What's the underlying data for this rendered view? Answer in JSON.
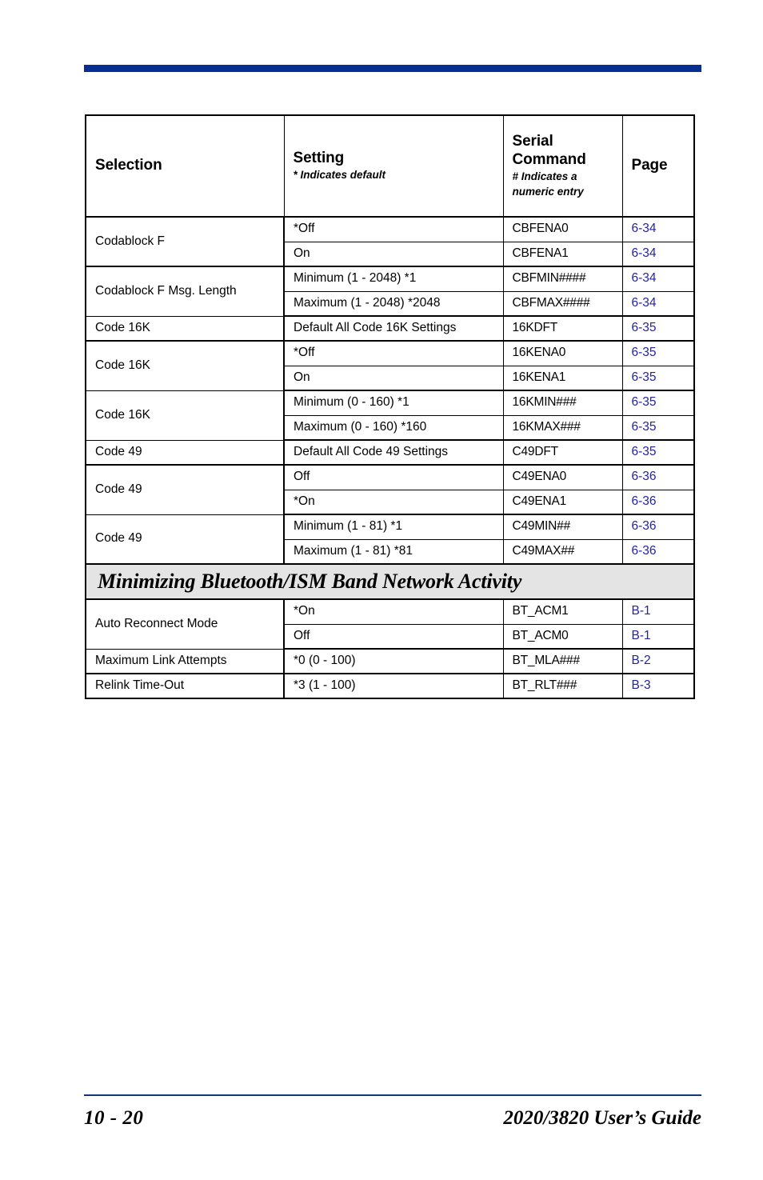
{
  "page": {
    "accent_blue": "#062f91",
    "link_blue": "#2222aa",
    "band_gray": "#e4e4e4"
  },
  "table": {
    "headers": {
      "selection": "Selection",
      "setting": "Setting",
      "setting_note": "* Indicates default",
      "serial_command_line1": "Serial",
      "serial_command_line2": "Command",
      "serial_command_note_line1": "# Indicates a",
      "serial_command_note_line2": "numeric entry",
      "page": "Page"
    },
    "rows": [
      {
        "selection": "Codablock F",
        "setting": "*Off",
        "command": "CBFENA0",
        "page": "6-34"
      },
      {
        "selection": "",
        "setting": "On",
        "command": "CBFENA1",
        "page": "6-34"
      },
      {
        "selection": "Codablock F Msg. Length",
        "setting": "Minimum (1 - 2048) *1",
        "command": "CBFMIN####",
        "page": "6-34"
      },
      {
        "selection": "",
        "setting": "Maximum (1 - 2048) *2048",
        "command": "CBFMAX####",
        "page": "6-34"
      },
      {
        "selection": "Code 16K",
        "setting": "Default All Code 16K Settings",
        "command": "16KDFT",
        "page": "6-35"
      },
      {
        "selection": "Code 16K",
        "setting": "*Off",
        "command": "16KENA0",
        "page": "6-35"
      },
      {
        "selection": "",
        "setting": "On",
        "command": "16KENA1",
        "page": "6-35"
      },
      {
        "selection": "Code 16K",
        "setting": "Minimum (0 - 160) *1",
        "command": "16KMIN###",
        "page": "6-35"
      },
      {
        "selection": "",
        "setting": "Maximum (0 - 160) *160",
        "command": "16KMAX###",
        "page": "6-35"
      },
      {
        "selection": "Code 49",
        "setting": "Default All Code 49 Settings",
        "command": "C49DFT",
        "page": "6-35"
      },
      {
        "selection": "Code 49",
        "setting": "Off",
        "command": "C49ENA0",
        "page": "6-36"
      },
      {
        "selection": "",
        "setting": "*On",
        "command": "C49ENA1",
        "page": "6-36"
      },
      {
        "selection": "Code 49",
        "setting": "Minimum (1 - 81) *1",
        "command": "C49MIN##",
        "page": "6-36"
      },
      {
        "selection": "",
        "setting": "Maximum (1 - 81) *81",
        "command": "C49MAX##",
        "page": "6-36"
      }
    ],
    "section_band": "Minimizing Bluetooth/ISM Band Network Activity",
    "rows_after_band": [
      {
        "selection": "Auto Reconnect Mode",
        "setting": "*On",
        "command": "BT_ACM1",
        "page": "B-1"
      },
      {
        "selection": "",
        "setting": "Off",
        "command": "BT_ACM0",
        "page": "B-1"
      },
      {
        "selection": "Maximum Link Attempts",
        "setting": "*0 (0 - 100)",
        "command": "BT_MLA###",
        "page": "B-2"
      },
      {
        "selection": "Relink Time-Out",
        "setting": "*3 (1 - 100)",
        "command": "BT_RLT###",
        "page": "B-3"
      }
    ]
  },
  "footer": {
    "page_number": "10 - 20",
    "guide_title": "2020/3820 User’s Guide"
  }
}
